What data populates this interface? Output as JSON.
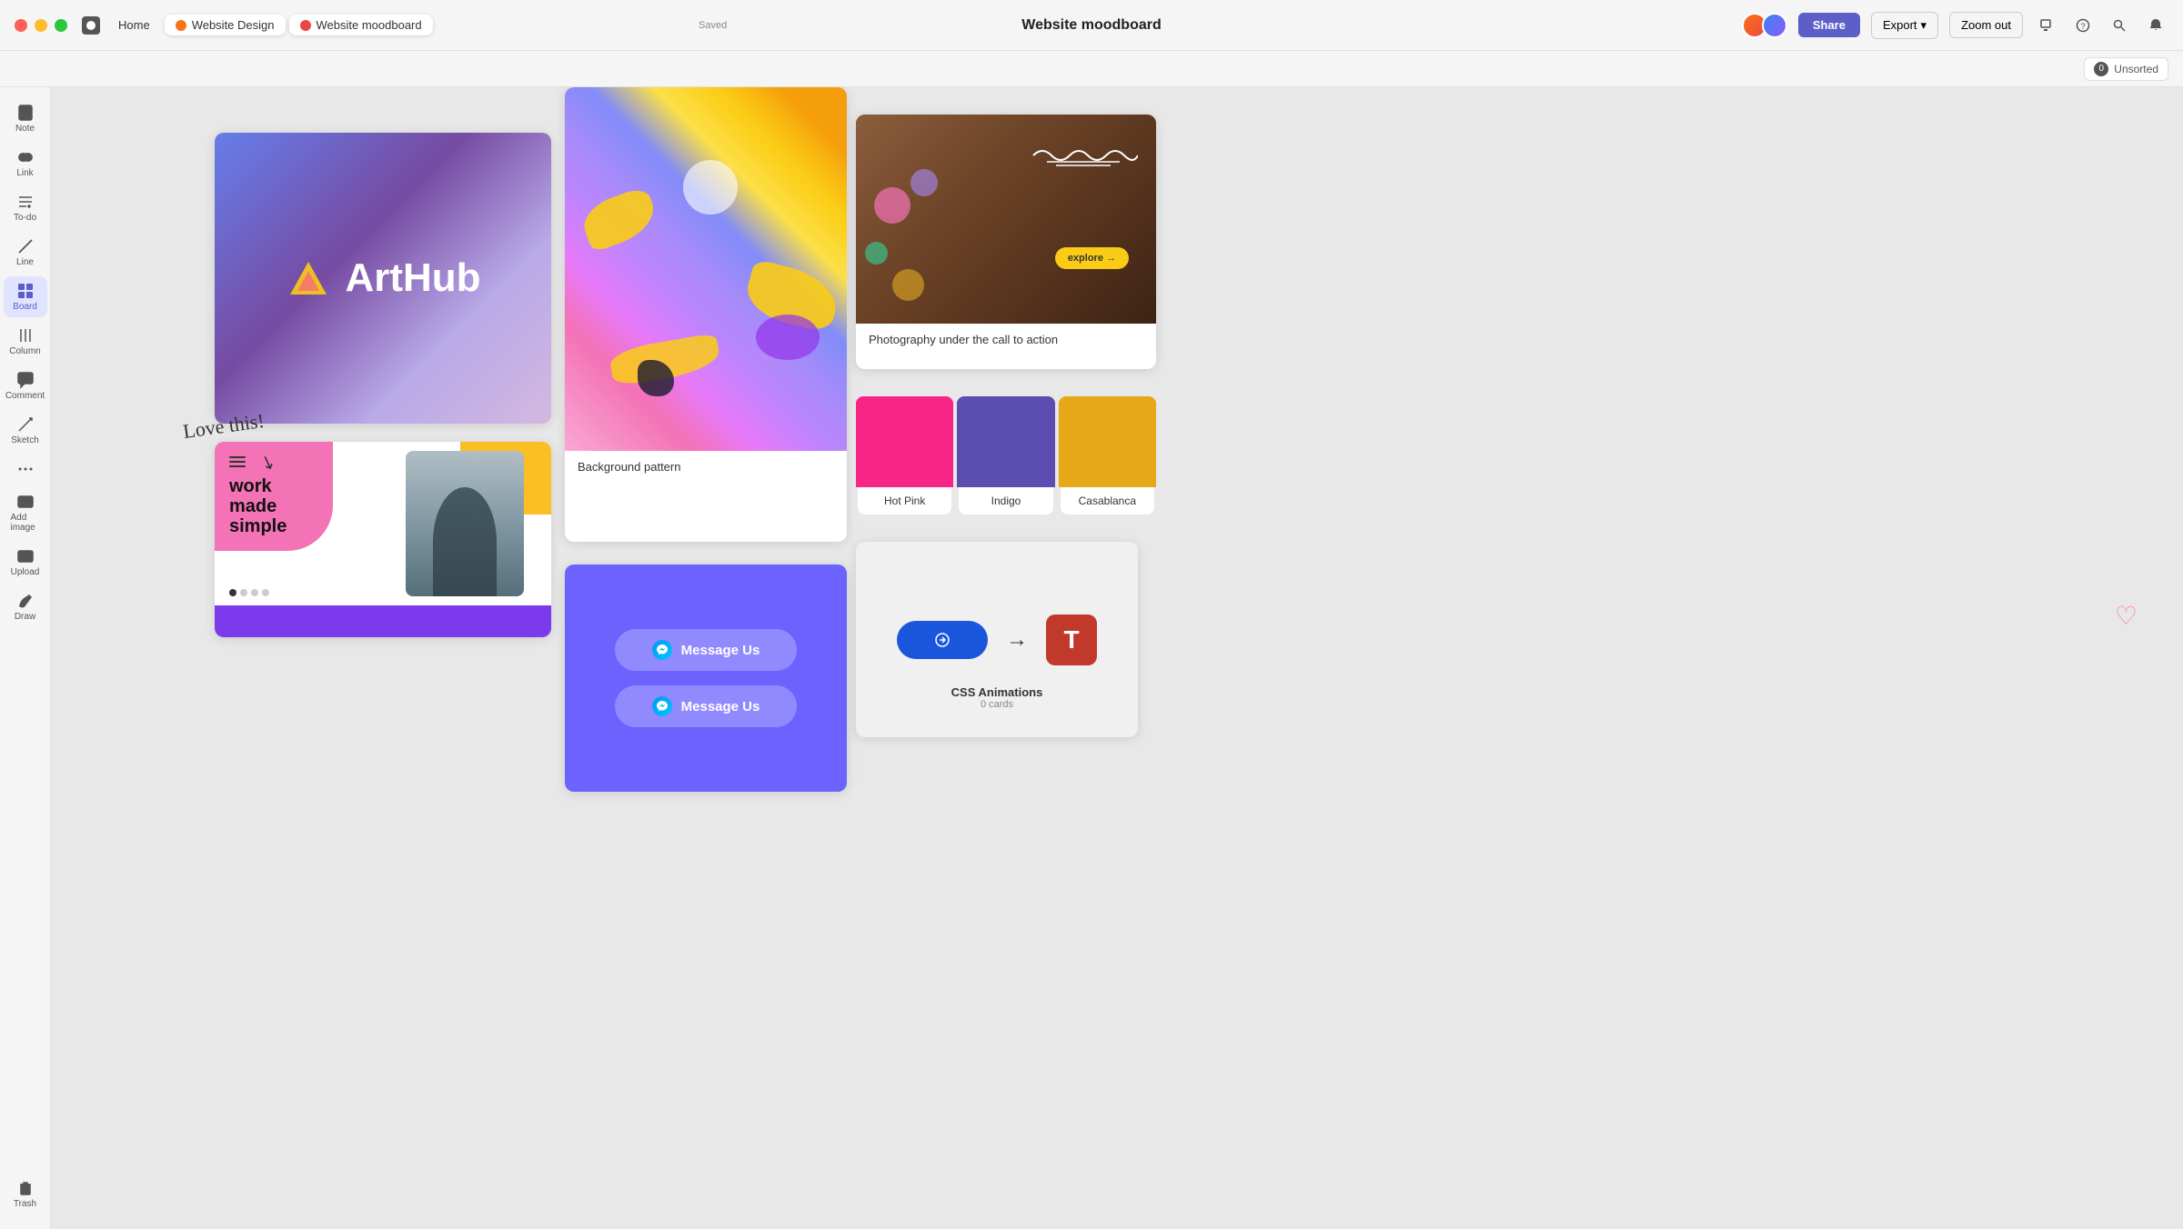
{
  "titlebar": {
    "tabs": [
      {
        "id": "home",
        "label": "Home",
        "dot_color": null,
        "active": false
      },
      {
        "id": "website-design",
        "label": "Website Design",
        "dot_color": "#f97316",
        "active": false
      },
      {
        "id": "website-moodboard",
        "label": "Website moodboard",
        "dot_color": "#ef4444",
        "active": true
      }
    ],
    "saved_label": "Saved",
    "page_title": "Website moodboard",
    "share_label": "Share",
    "export_label": "Export",
    "zoom_label": "Zoom out"
  },
  "toolbar": {
    "unsorted_count": "0",
    "unsorted_label": "Unsorted"
  },
  "sidebar": {
    "items": [
      {
        "id": "note",
        "label": "Note",
        "icon": "note-icon"
      },
      {
        "id": "link",
        "label": "Link",
        "icon": "link-icon"
      },
      {
        "id": "todo",
        "label": "To-do",
        "icon": "todo-icon"
      },
      {
        "id": "line",
        "label": "Line",
        "icon": "line-icon"
      },
      {
        "id": "board",
        "label": "Board",
        "icon": "board-icon",
        "active": true
      },
      {
        "id": "column",
        "label": "Column",
        "icon": "column-icon"
      },
      {
        "id": "comment",
        "label": "Comment",
        "icon": "comment-icon"
      },
      {
        "id": "sketch",
        "label": "Sketch",
        "icon": "sketch-icon"
      },
      {
        "id": "more",
        "label": "",
        "icon": "more-icon"
      },
      {
        "id": "add-image",
        "label": "Add image",
        "icon": "add-image-icon"
      },
      {
        "id": "upload",
        "label": "Upload",
        "icon": "upload-icon"
      },
      {
        "id": "draw",
        "label": "Draw",
        "icon": "draw-icon"
      }
    ],
    "trash_label": "Trash"
  },
  "canvas": {
    "arthub": {
      "logo_text": "ArtHub"
    },
    "work": {
      "title": "work\nmade\nsimple"
    },
    "background_pattern": {
      "label": "Background pattern"
    },
    "photo": {
      "label": "Photography under the call to action",
      "cta_text": "explore →"
    },
    "swatches": [
      {
        "name": "Hot Pink",
        "color": "#f72585"
      },
      {
        "name": "Indigo",
        "color": "#5c4db1"
      },
      {
        "name": "Casablanca",
        "color": "#e6a817"
      }
    ],
    "messenger": {
      "btn1": "Message Us",
      "btn2": "Message Us"
    },
    "css_animations": {
      "title": "CSS Animations",
      "subtitle": "0 cards"
    },
    "annotation": "Love this!"
  },
  "colors": {
    "sidebar_bg": "#f5f5f5",
    "canvas_bg": "#e8e8e8",
    "active_sidebar": "#5b5fc7",
    "share_btn": "#5b5fc7"
  }
}
